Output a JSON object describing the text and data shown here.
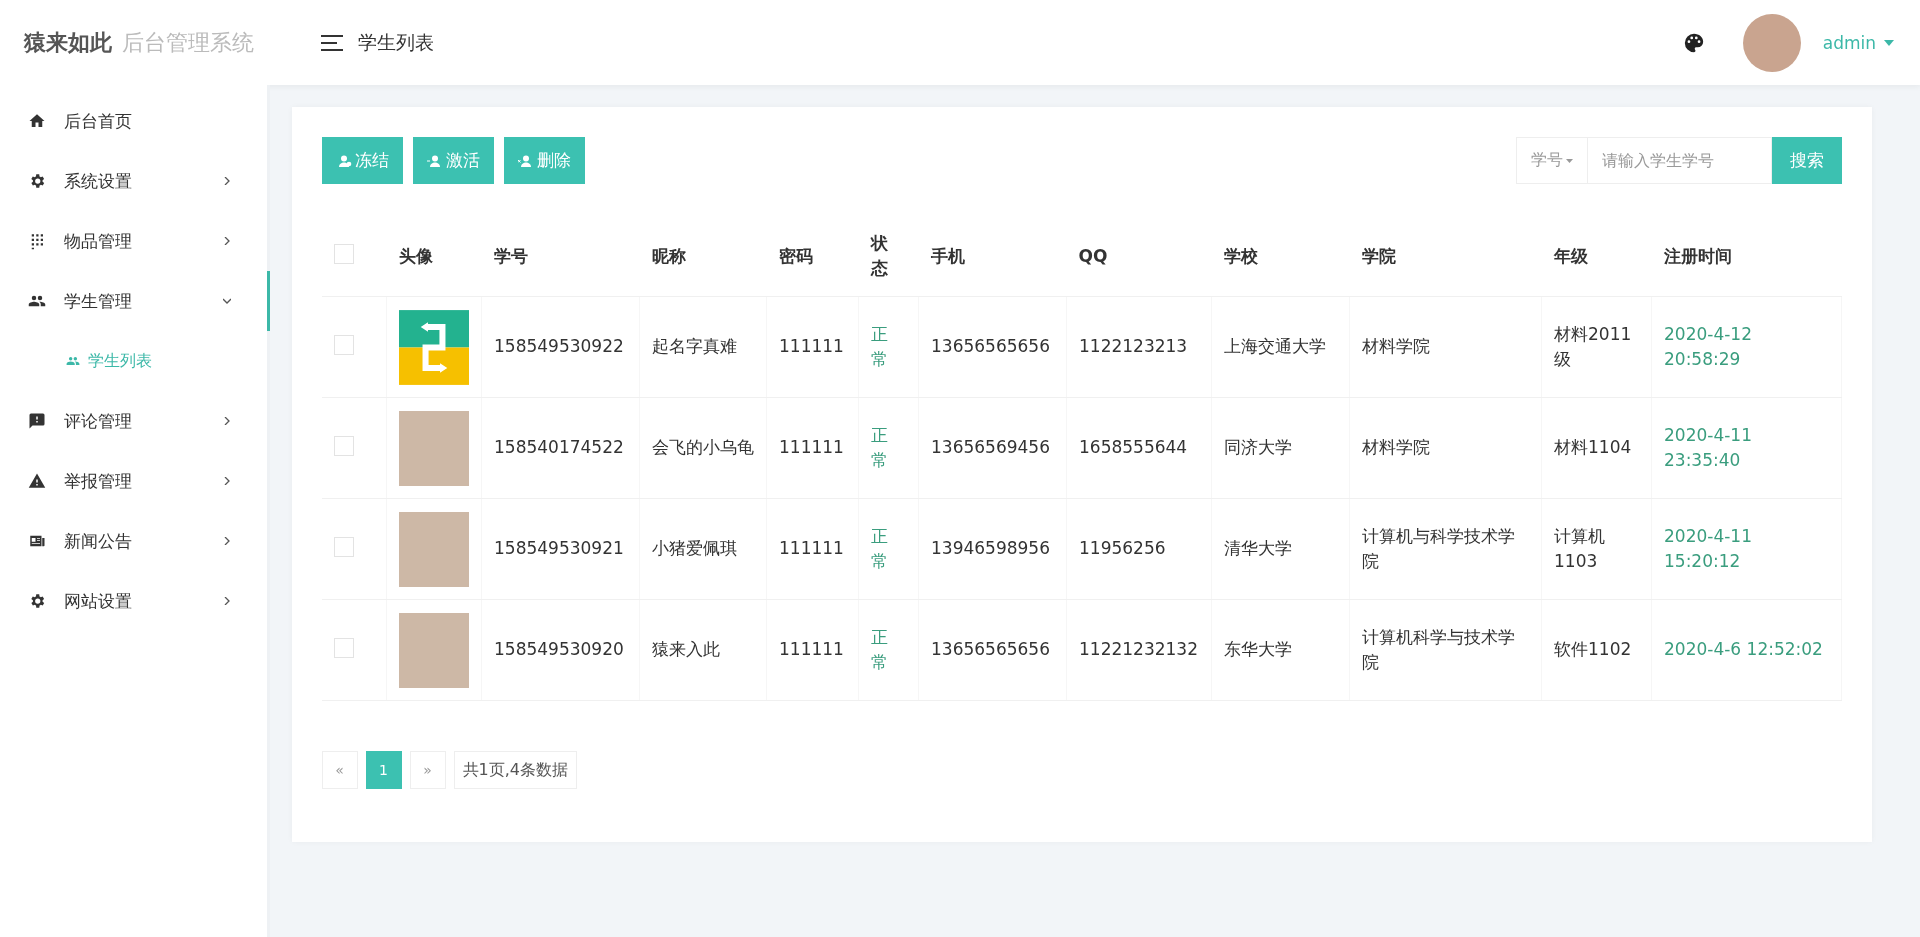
{
  "header": {
    "logo": "猿来如此",
    "system_name": "后台管理系统",
    "page_title": "学生列表",
    "user": "admin"
  },
  "sidebar": {
    "items": [
      {
        "label": "后台首页",
        "has_children": false,
        "expanded": false
      },
      {
        "label": "系统设置",
        "has_children": true,
        "expanded": false
      },
      {
        "label": "物品管理",
        "has_children": true,
        "expanded": false
      },
      {
        "label": "学生管理",
        "has_children": true,
        "expanded": true,
        "children": [
          {
            "label": "学生列表",
            "selected": true
          }
        ]
      },
      {
        "label": "评论管理",
        "has_children": true,
        "expanded": false
      },
      {
        "label": "举报管理",
        "has_children": true,
        "expanded": false
      },
      {
        "label": "新闻公告",
        "has_children": true,
        "expanded": false
      },
      {
        "label": "网站设置",
        "has_children": true,
        "expanded": false
      }
    ]
  },
  "toolbar": {
    "buttons": [
      {
        "label": "冻结"
      },
      {
        "label": "激活"
      },
      {
        "label": "删除"
      }
    ],
    "search": {
      "filter": "学号",
      "placeholder": "请输入学生学号",
      "button": "搜索"
    }
  },
  "table": {
    "columns": [
      "头像",
      "学号",
      "昵称",
      "密码",
      "状态",
      "手机",
      "QQ",
      "学校",
      "学院",
      "年级",
      "注册时间"
    ],
    "select_all_checked": false,
    "rows": [
      {
        "checked": false,
        "kind": "drawing",
        "id": "158549530922",
        "nickname": "起名字真难",
        "password": "111111",
        "status": "正常",
        "phone": "13656565656",
        "qq": "1122123213",
        "school": "上海交通大学",
        "college": "材料学院",
        "grade": "材料2011级",
        "registered": "2020-4-12 20:58:29"
      },
      {
        "checked": false,
        "kind": "photo",
        "id": "158540174522",
        "nickname": "会飞的小乌龟",
        "password": "111111",
        "status": "正常",
        "phone": "13656569456",
        "qq": "1658555644",
        "school": "同济大学",
        "college": "材料学院",
        "grade": "材料1104",
        "registered": "2020-4-11 23:35:40"
      },
      {
        "checked": false,
        "kind": "photo",
        "id": "158549530921",
        "nickname": "小猪爱佩琪",
        "password": "111111",
        "status": "正常",
        "phone": "13946598956",
        "qq": "11956256",
        "school": "清华大学",
        "college": "计算机与科学技术学院",
        "grade": "计算机1103",
        "registered": "2020-4-11 15:20:12"
      },
      {
        "checked": false,
        "kind": "photo",
        "id": "158549530920",
        "nickname": "猿来入此",
        "password": "111111",
        "status": "正常",
        "phone": "13656565656",
        "qq": "11221232132",
        "school": "东华大学",
        "college": "计算机科学与技术学院",
        "grade": "软件1102",
        "registered": "2020-4-6 12:52:02"
      }
    ]
  },
  "pagination": {
    "prev": "«",
    "pages": [
      {
        "label": "1",
        "selected": true
      }
    ],
    "next": "»",
    "summary": "共1页,4条数据"
  }
}
